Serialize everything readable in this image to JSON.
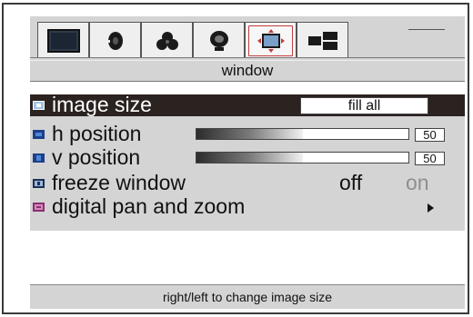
{
  "tabs": [
    {
      "name": "picture",
      "icon": "monitor-screen-icon",
      "active": false
    },
    {
      "name": "audio",
      "icon": "speaker-icon",
      "active": false
    },
    {
      "name": "color",
      "icon": "color-circles-icon",
      "active": false
    },
    {
      "name": "setup",
      "icon": "satellite-dish-icon",
      "active": false
    },
    {
      "name": "window",
      "icon": "window-resize-icon",
      "active": true
    },
    {
      "name": "layout",
      "icon": "multi-window-icon",
      "active": false
    }
  ],
  "window_title": "window",
  "menu": {
    "image_size": {
      "label": "image size",
      "value": "fill all",
      "icon": "image-size-icon"
    },
    "h_position": {
      "label": "h position",
      "value": "50",
      "level": 0.5,
      "icon": "h-position-icon"
    },
    "v_position": {
      "label": "v position",
      "value": "50",
      "level": 0.5,
      "icon": "v-position-icon"
    },
    "freeze_window": {
      "label": "freeze window",
      "off_label": "off",
      "on_label": "on",
      "selected": "off",
      "icon": "freeze-icon"
    },
    "digital_pan": {
      "label": "digital pan and zoom",
      "icon": "pan-zoom-icon"
    }
  },
  "help_text": "right/left to change image size",
  "colors": {
    "panel": "#d4d4d4",
    "selected_row": "#2a2320",
    "active_tab_highlight": "#c43c3c",
    "disabled_text": "#8f8f8f"
  }
}
